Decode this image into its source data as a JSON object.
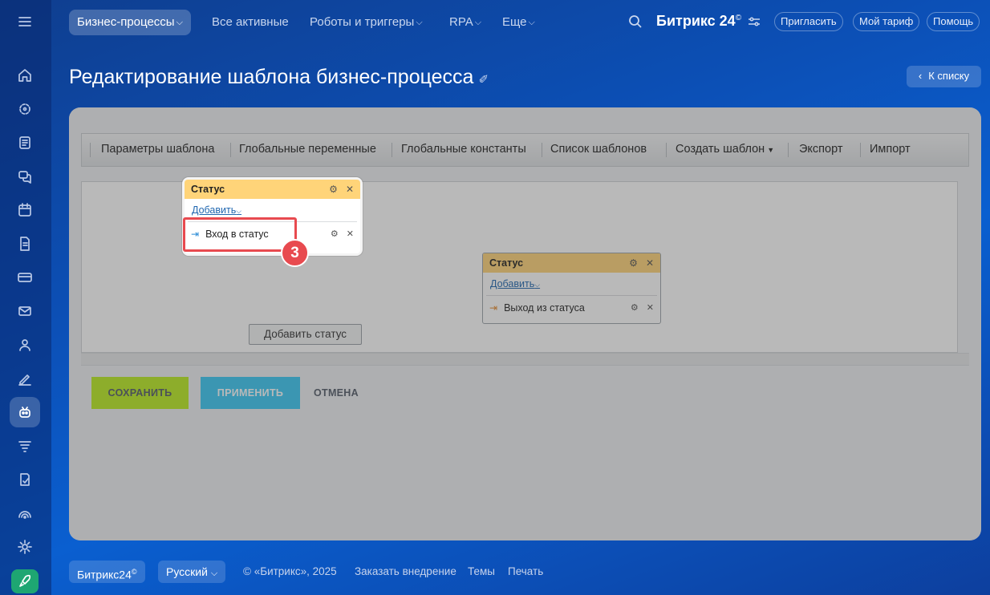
{
  "topnav": {
    "items": [
      {
        "label": "Бизнес-процессы",
        "chevron": "⌵"
      },
      {
        "label": "Все активные"
      },
      {
        "label": "Роботы и триггеры",
        "chevron": "⌵"
      },
      {
        "label": "RPA",
        "chevron": "⌵"
      },
      {
        "label": "Еще",
        "chevron": "⌵"
      }
    ],
    "brand": "Битрикс 24",
    "brand_mark": "©",
    "invite": "Пригласить",
    "tariff": "Мой тариф",
    "help": "Помощь"
  },
  "page": {
    "title": "Редактирование шаблона бизнес-процесса",
    "back": "К списку"
  },
  "toolbar": {
    "items": [
      "Параметры шаблона",
      "Глобальные переменные",
      "Глобальные константы",
      "Список шаблонов",
      "Создать шаблон",
      "Экспорт",
      "Импорт"
    ]
  },
  "status1": {
    "title": "Статус",
    "add": "Добавить",
    "add_chevron": "⌵",
    "row": "Вход в статус"
  },
  "status2": {
    "title": "Статус",
    "add": "Добавить",
    "add_chevron": "⌵",
    "row": "Выход из статуса"
  },
  "canvas": {
    "add_status": "Добавить статус"
  },
  "actions": {
    "save": "СОХРАНИТЬ",
    "apply": "ПРИМЕНИТЬ",
    "cancel": "ОТМЕНА"
  },
  "callout": {
    "number": "3"
  },
  "footer": {
    "brand": "Битрикс24",
    "brand_mark": "©",
    "language": "Русский",
    "language_chevron": "⌵",
    "copyright": "© «Битрикс», 2025",
    "order": "Заказать внедрение",
    "themes": "Темы",
    "print": "Печать"
  },
  "colors": {
    "status_header": "#ffd479",
    "save": "#bbed21",
    "apply": "#3bc8f5",
    "highlight": "#e84a4f"
  }
}
